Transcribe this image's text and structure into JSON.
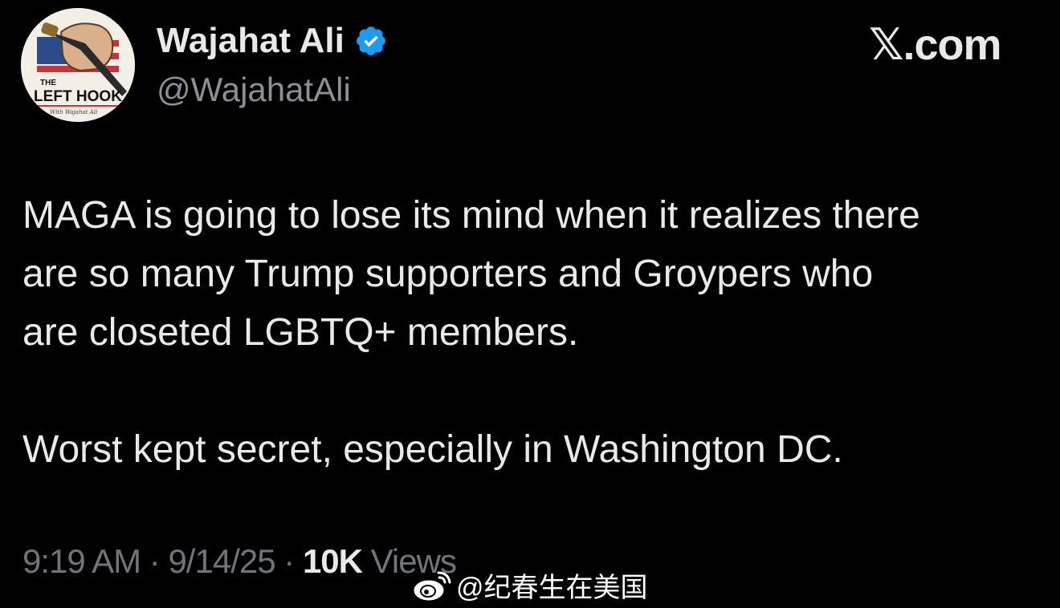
{
  "author": {
    "display_name": "Wajahat Ali",
    "handle": "@WajahatAli",
    "verified_icon": "verified-badge-icon",
    "avatar": {
      "lettering_top": "THE",
      "lettering_main": "LEFT HOOK",
      "lettering_script": "With Wajahat Ali"
    }
  },
  "brand": "𝕏.com",
  "tweet": {
    "lines_paragraph_1": [
      "MAGA is going to lose its mind when it realizes there",
      "are so many Trump supporters and Groypers who",
      "are closeted LGBTQ+ members."
    ],
    "paragraph_2": "Worst kept secret, especially in Washington DC."
  },
  "meta": {
    "time": "9:19 AM",
    "separator": "·",
    "date": "9/14/25",
    "views_count": "10K",
    "views_label": "Views"
  },
  "watermark": {
    "icon": "weibo-icon",
    "text": "@纪春生在美国"
  },
  "colors": {
    "background": "#000000",
    "text_primary": "#e7e9ea",
    "text_secondary": "#8b9096",
    "verified_blue": "#1d9bf0"
  }
}
